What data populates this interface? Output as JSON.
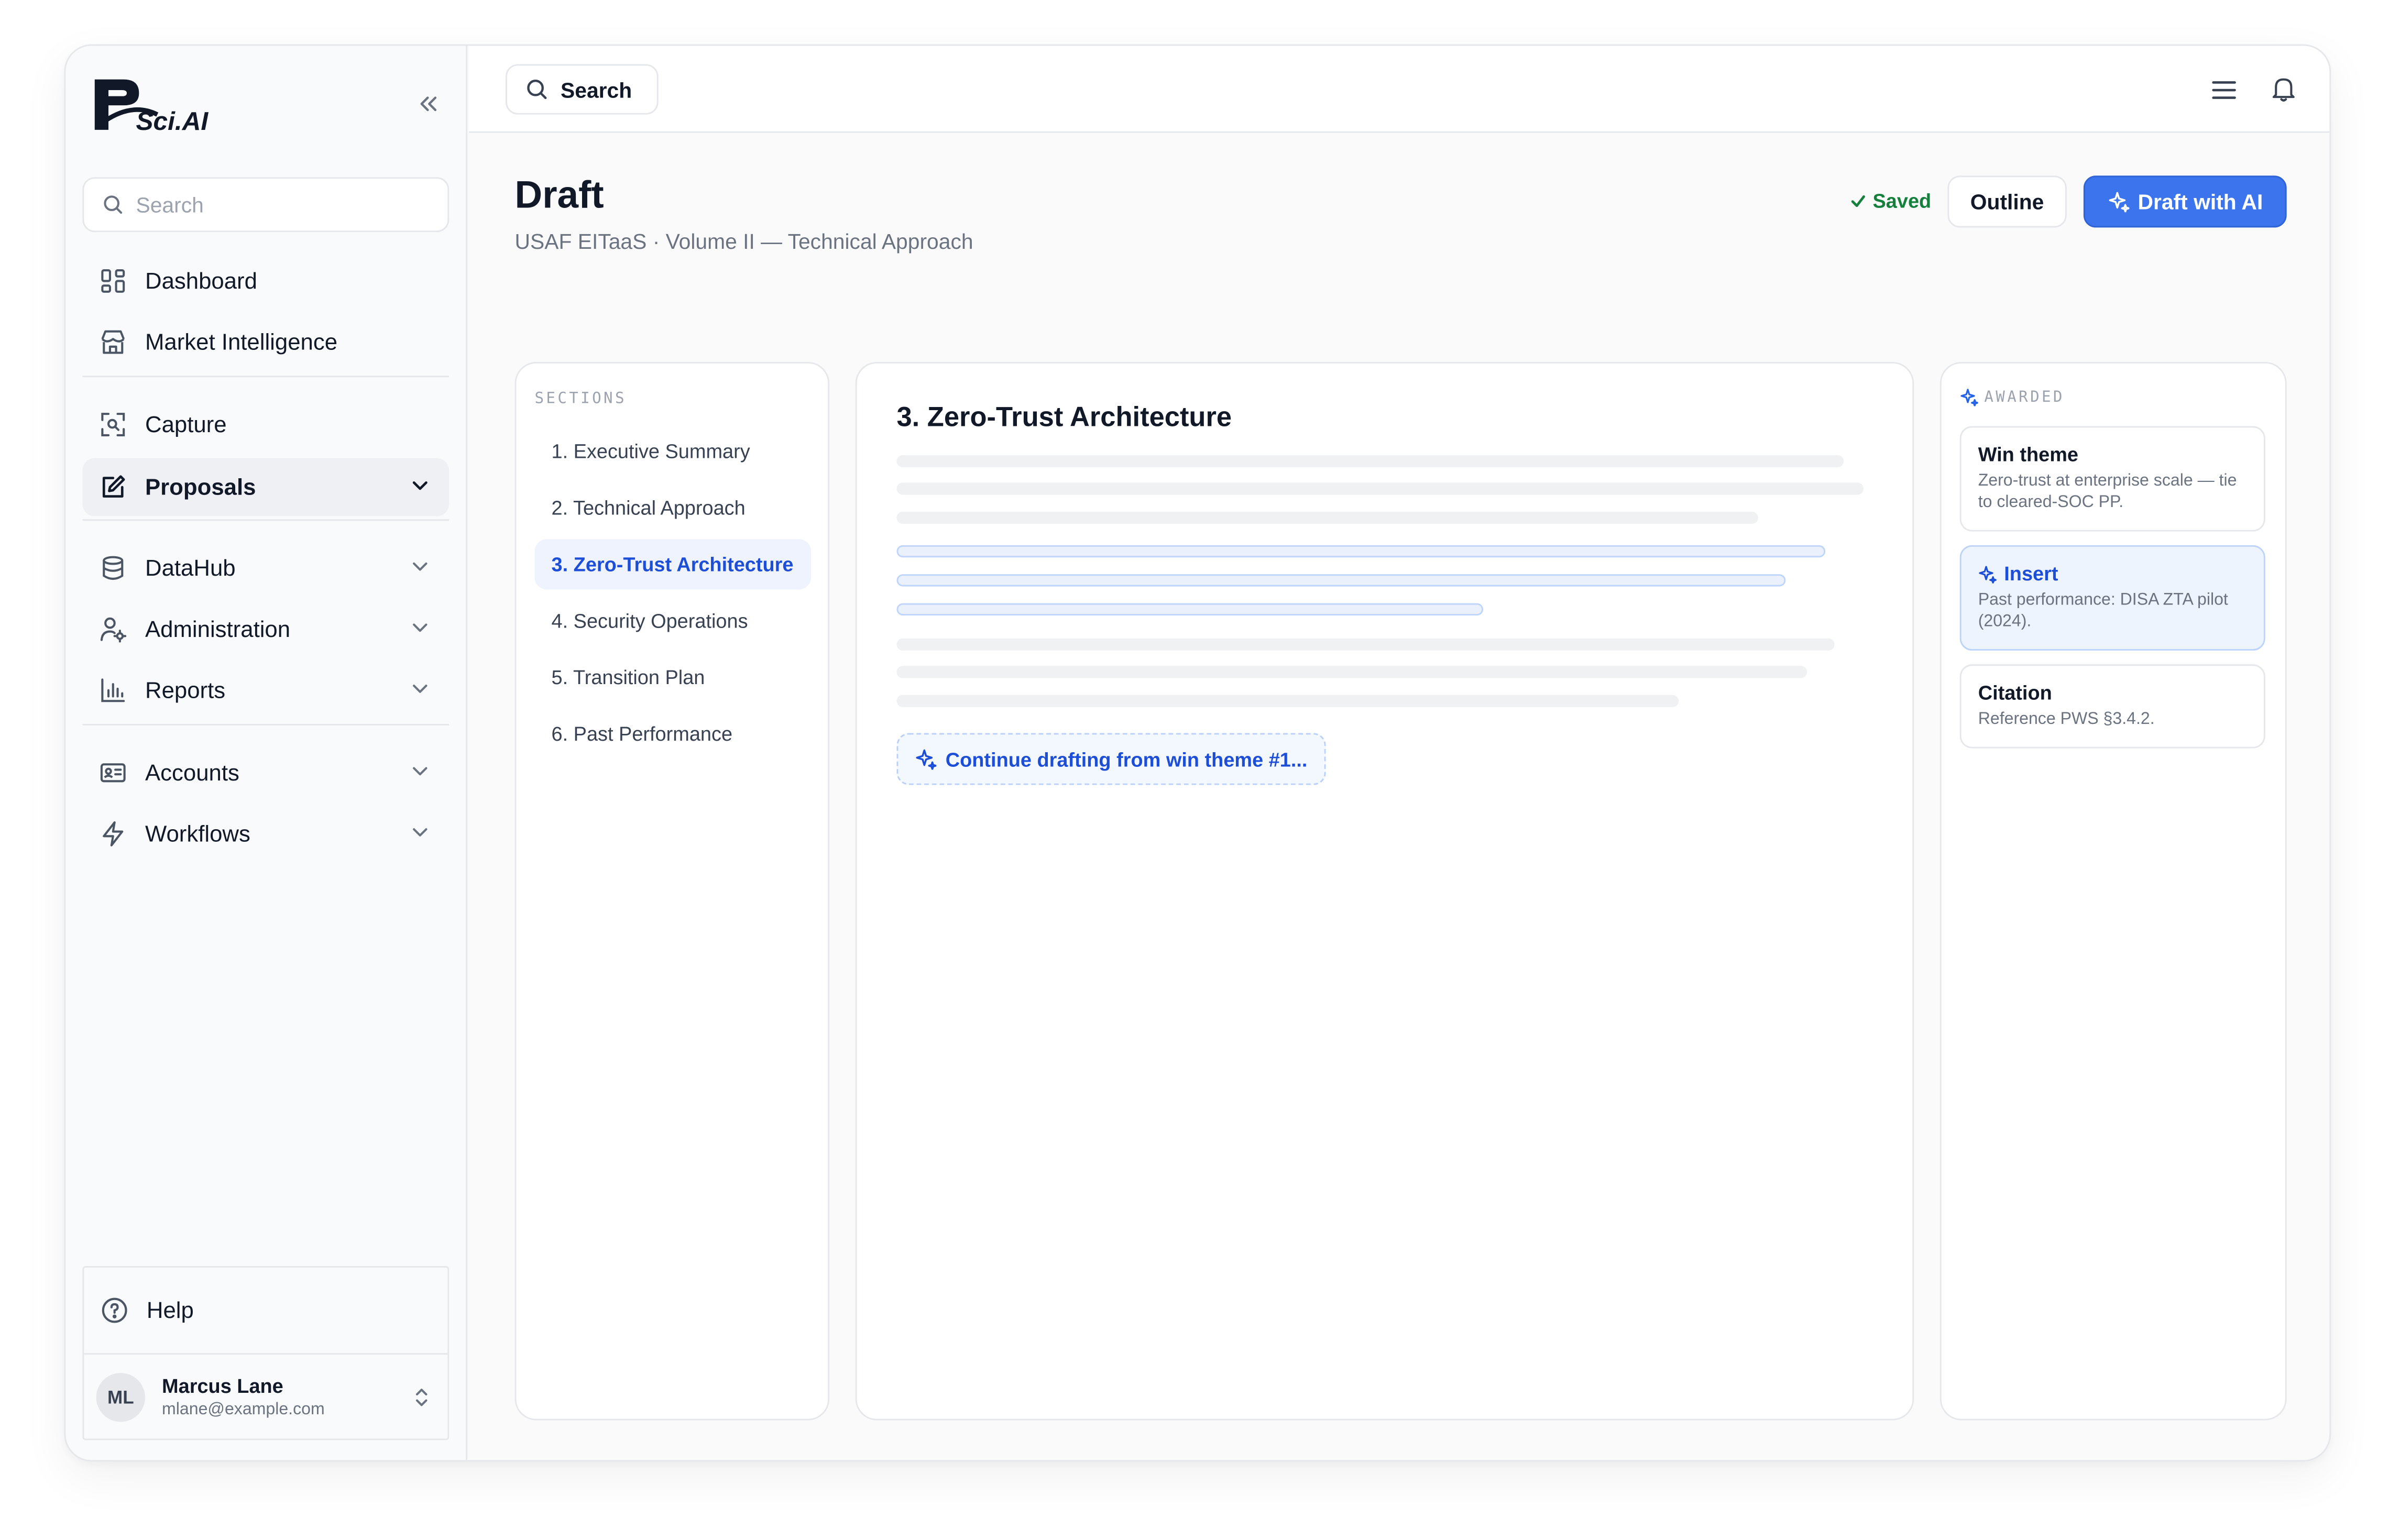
{
  "brand": {
    "logo_text": "RSci.AI"
  },
  "sidebar": {
    "search_placeholder": "Search",
    "items": [
      {
        "label": "Dashboard",
        "icon": "dashboard-icon"
      },
      {
        "label": "Market Intelligence",
        "icon": "storefront-icon"
      },
      {
        "label": "Capture",
        "icon": "scan-icon"
      },
      {
        "label": "Proposals",
        "icon": "edit-icon",
        "active": true,
        "expanded": true
      },
      {
        "label": "DataHub",
        "icon": "database-icon"
      },
      {
        "label": "Administration",
        "icon": "user-gear-icon"
      },
      {
        "label": "Reports",
        "icon": "bar-chart-icon"
      },
      {
        "label": "Accounts",
        "icon": "id-card-icon"
      },
      {
        "label": "Workflows",
        "icon": "bolt-icon"
      }
    ],
    "help_label": "Help",
    "user": {
      "initials": "ML",
      "name": "Marcus Lane",
      "email": "mlane@example.com"
    }
  },
  "topbar": {
    "search_label": "Search"
  },
  "header": {
    "title": "Draft",
    "subtitle": "USAF EITaaS · Volume II — Technical Approach",
    "saved_label": "Saved",
    "outline_label": "Outline",
    "draft_ai_label": "Draft with AI"
  },
  "sections": {
    "caption": "SECTIONS",
    "items": [
      "1. Executive Summary",
      "2. Technical Approach",
      "3. Zero-Trust Architecture",
      "4. Security Operations",
      "5. Transition Plan",
      "6. Past Performance"
    ],
    "active_index": 2
  },
  "editor": {
    "title": "3. Zero-Trust Architecture",
    "continue_label": "Continue drafting from win theme #1..."
  },
  "awarded": {
    "caption": "AWARDED",
    "cards": [
      {
        "title": "Win theme",
        "body": "Zero-trust at enterprise scale — tie to cleared-SOC PP."
      },
      {
        "title": "Insert",
        "body": "Past performance: DISA ZTA pilot (2024).",
        "highlight": true
      },
      {
        "title": "Citation",
        "body": "Reference PWS §3.4.2."
      }
    ]
  },
  "colors": {
    "accent": "#3b74ec",
    "saved": "#15803d",
    "active_text": "#1d4ed8"
  }
}
